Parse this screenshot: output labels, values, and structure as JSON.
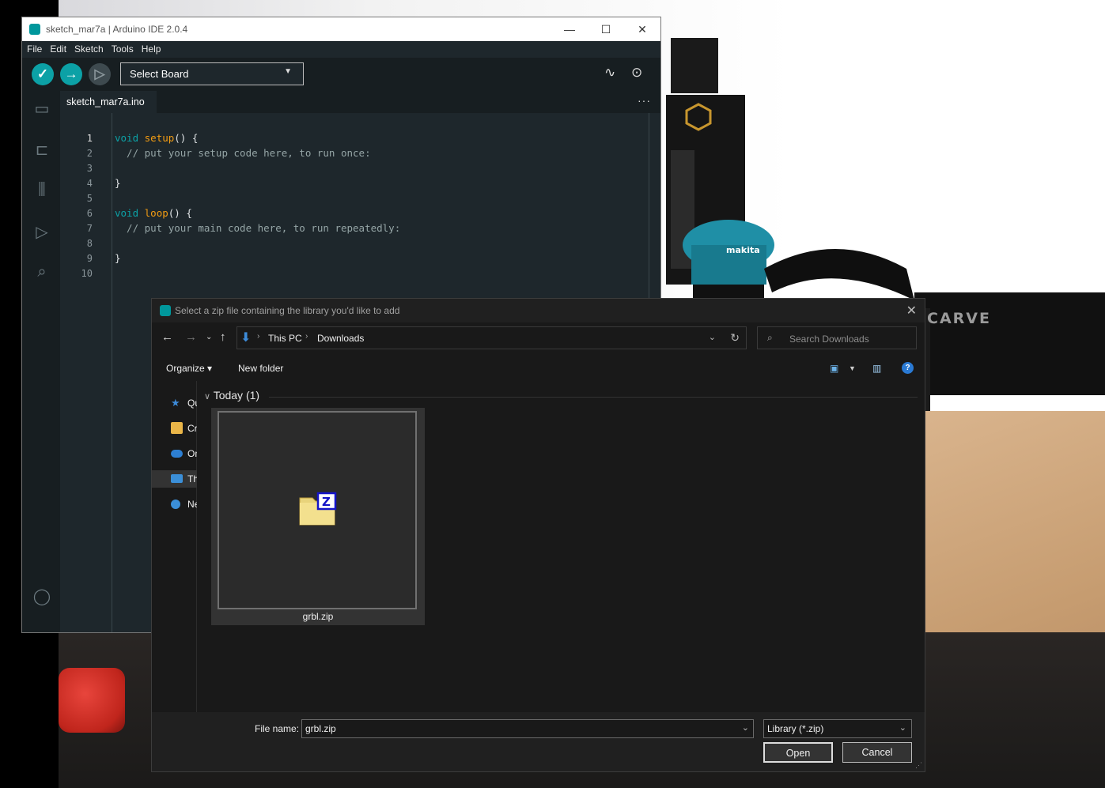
{
  "ide": {
    "title": "sketch_mar7a | Arduino IDE 2.0.4",
    "window_controls": {
      "minimize": "—",
      "maximize": "☐",
      "close": "✕"
    },
    "menu": [
      "File",
      "Edit",
      "Sketch",
      "Tools",
      "Help"
    ],
    "board_select": "Select Board",
    "tab_name": "sketch_mar7a.ino",
    "tab_more": "···",
    "code_lines": [
      {
        "n": "1",
        "parts": [
          [
            "kw",
            "void "
          ],
          [
            "fn",
            "setup"
          ],
          [
            "",
            "() {"
          ]
        ]
      },
      {
        "n": "2",
        "parts": [
          [
            "cm",
            "  // put your setup code here, to run once:"
          ]
        ]
      },
      {
        "n": "3",
        "parts": [
          [
            "",
            ""
          ]
        ]
      },
      {
        "n": "4",
        "parts": [
          [
            "",
            "}"
          ]
        ]
      },
      {
        "n": "5",
        "parts": [
          [
            "",
            ""
          ]
        ]
      },
      {
        "n": "6",
        "parts": [
          [
            "kw",
            "void "
          ],
          [
            "fn",
            "loop"
          ],
          [
            "",
            "() {"
          ]
        ]
      },
      {
        "n": "7",
        "parts": [
          [
            "cm",
            "  // put your main code here, to run repeatedly:"
          ]
        ]
      },
      {
        "n": "8",
        "parts": [
          [
            "",
            ""
          ]
        ]
      },
      {
        "n": "9",
        "parts": [
          [
            "",
            "}"
          ]
        ]
      },
      {
        "n": "10",
        "parts": [
          [
            "",
            ""
          ]
        ]
      }
    ],
    "accent_color": "#00979c"
  },
  "dialog": {
    "title": "Select a zip file containing the library you'd like to add",
    "breadcrumb": [
      "This PC",
      "Downloads"
    ],
    "search_placeholder": "Search Downloads",
    "organize_label": "Organize ▾",
    "new_folder_label": "New folder",
    "nav_items": [
      {
        "label": "Quick access",
        "icon": "star-icon",
        "color": "#3d8bd9"
      },
      {
        "label": "Creative Cloud Files",
        "icon": "cloud-folder-icon",
        "color": "#e9b548"
      },
      {
        "label": "OneDrive",
        "icon": "onedrive-icon",
        "color": "#2d7fd3"
      },
      {
        "label": "This PC",
        "icon": "computer-icon",
        "color": "#3b8fd8"
      },
      {
        "label": "Network",
        "icon": "network-icon",
        "color": "#3b8fd8"
      }
    ],
    "group_label": "Today (1)",
    "file": {
      "name": "grbl.zip",
      "icon": "zip-folder-icon"
    },
    "file_name_label": "File name:",
    "file_name_value": "grbl.zip",
    "file_type_value": "Library (*.zip)",
    "open_label": "Open",
    "cancel_label": "Cancel"
  },
  "background": {
    "carve_text": "CARVE"
  }
}
